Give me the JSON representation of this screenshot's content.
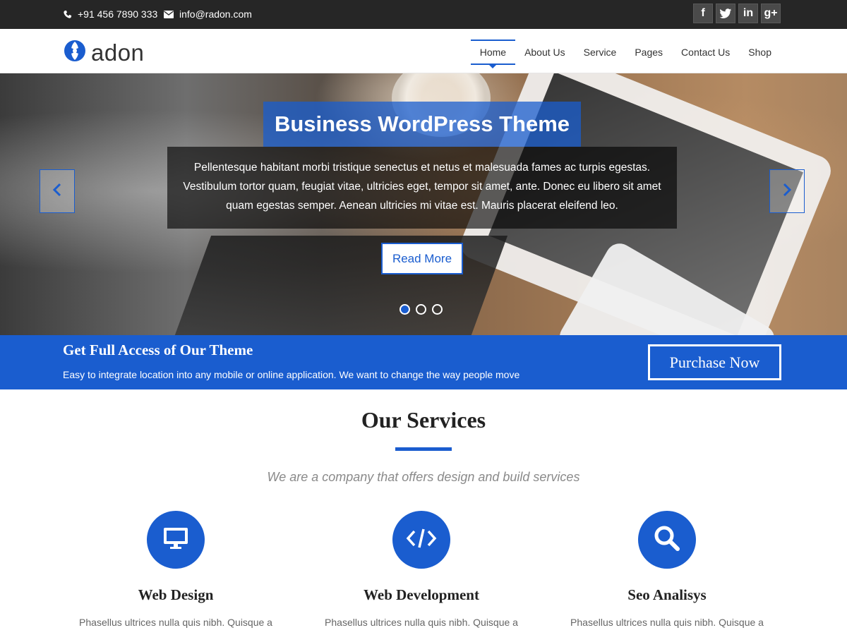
{
  "topbar": {
    "phone": "+91 456 7890 333",
    "email": "info@radon.com",
    "socials": [
      {
        "icon": "facebook-icon",
        "glyph": "f"
      },
      {
        "icon": "twitter-icon",
        "glyph": "t"
      },
      {
        "icon": "linkedin-icon",
        "glyph": "in"
      },
      {
        "icon": "google-plus-icon",
        "glyph": "g+"
      }
    ]
  },
  "header": {
    "logo_text": "adon",
    "nav": [
      "Home",
      "About Us",
      "Service",
      "Pages",
      "Contact Us",
      "Shop"
    ],
    "active_nav": "Home"
  },
  "hero": {
    "title": "Business WordPress Theme",
    "description": "Pellentesque habitant morbi tristique senectus et netus et malesuada fames ac turpis egestas. Vestibulum tortor quam, feugiat vitae, ultricies eget, tempor sit amet, ante. Donec eu libero sit amet quam egestas semper. Aenean ultricies mi vitae est. Mauris placerat eleifend leo.",
    "button": "Read More",
    "slides": 3,
    "active_slide": 1
  },
  "banner": {
    "title": "Get Full Access of Our Theme",
    "subtitle": "Easy to integrate location into any mobile or online application. We want to change the way people move",
    "button": "Purchase Now"
  },
  "services": {
    "title": "Our Services",
    "subtitle": "We are a company that offers design and build services",
    "items": [
      {
        "name": "Web Design",
        "text": "Phasellus ultrices nulla quis nibh. Quisque a",
        "icon": "monitor-icon"
      },
      {
        "name": "Web Development",
        "text": "Phasellus ultrices nulla quis nibh. Quisque a",
        "icon": "code-icon"
      },
      {
        "name": "Seo Analisys",
        "text": "Phasellus ultrices nulla quis nibh. Quisque a",
        "icon": "search-icon"
      }
    ]
  },
  "colors": {
    "accent": "#1a5dcf",
    "topbar": "#262626"
  }
}
